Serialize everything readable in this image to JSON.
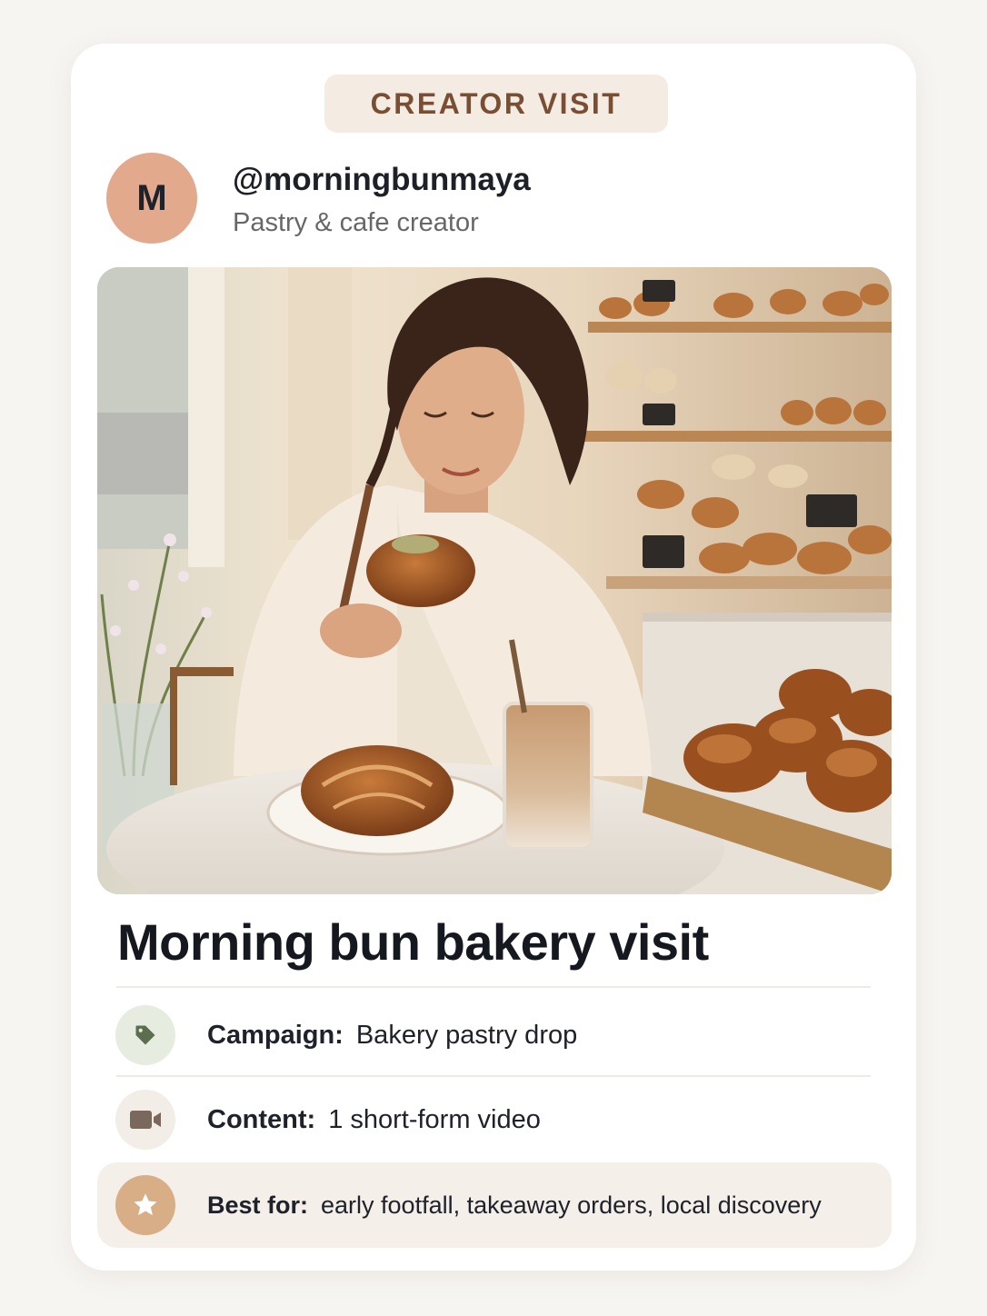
{
  "header": {
    "badge": "CREATOR VISIT"
  },
  "creator": {
    "avatar_initial": "M",
    "handle": "@morningbunmaya",
    "role": "Pastry & cafe creator"
  },
  "post": {
    "image_alt": "Creator tasting a morning bun at a sunny bakery table with an iced latte and pastry shelves behind",
    "title": "Morning bun bakery visit"
  },
  "details": [
    {
      "key": "Campaign:",
      "value": "Bakery pastry drop",
      "icon": "tag-icon",
      "icon_bg": "#e6ede0",
      "icon_color": "#5c6e4d"
    },
    {
      "key": "Content:",
      "value": "1 short-form video",
      "icon": "video-camera-icon",
      "icon_bg": "#f3ede7",
      "icon_color": "#7b685c"
    },
    {
      "key": "Best for:",
      "value": "early footfall, takeaway orders, local discovery",
      "icon": "star-icon",
      "icon_bg": "#d8ae87",
      "icon_color": "#ffffff"
    }
  ],
  "colors": {
    "page_bg": "#f7f5f2",
    "card_bg": "#ffffff",
    "badge_bg": "#f4ebe2",
    "badge_text": "#7a4e33",
    "avatar_bg": "#e3a98d",
    "highlight_bg": "#f4efe9"
  }
}
